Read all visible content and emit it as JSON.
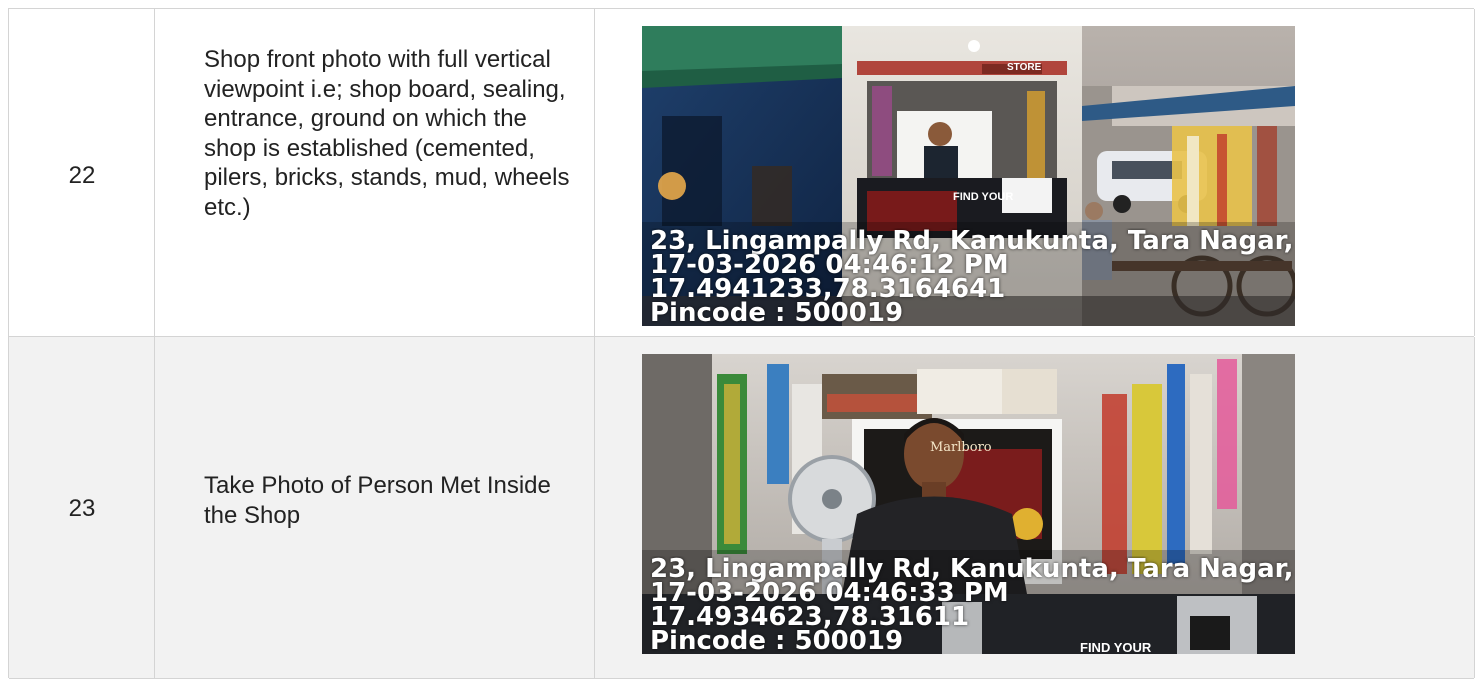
{
  "rows": [
    {
      "number": "22",
      "description": "Shop front photo with full vertical viewpoint i.e; shop board, sealing, entrance, ground on which the shop is established (cemented, pilers, bricks, stands, mud, wheels etc.)",
      "photo": {
        "store_sign": "STORE",
        "board_text": "FIND YOUR",
        "address": "23, Lingampally Rd, Kanukunta, Tara Nagar, .",
        "datetime": "17-03-2026 04:46:12 PM",
        "coordinates": "17.4941233,78.3164641",
        "pincode": "Pincode : 500019"
      }
    },
    {
      "number": "23",
      "description": "Take Photo of Person Met Inside the Shop",
      "photo": {
        "brand_text": "Marlboro",
        "board_text": "FIND YOUR",
        "address": "23, Lingampally Rd, Kanukunta, Tara Nagar, .",
        "datetime": "17-03-2026 04:46:33 PM",
        "coordinates": "17.4934623,78.31611",
        "pincode": "Pincode : 500019"
      }
    }
  ]
}
